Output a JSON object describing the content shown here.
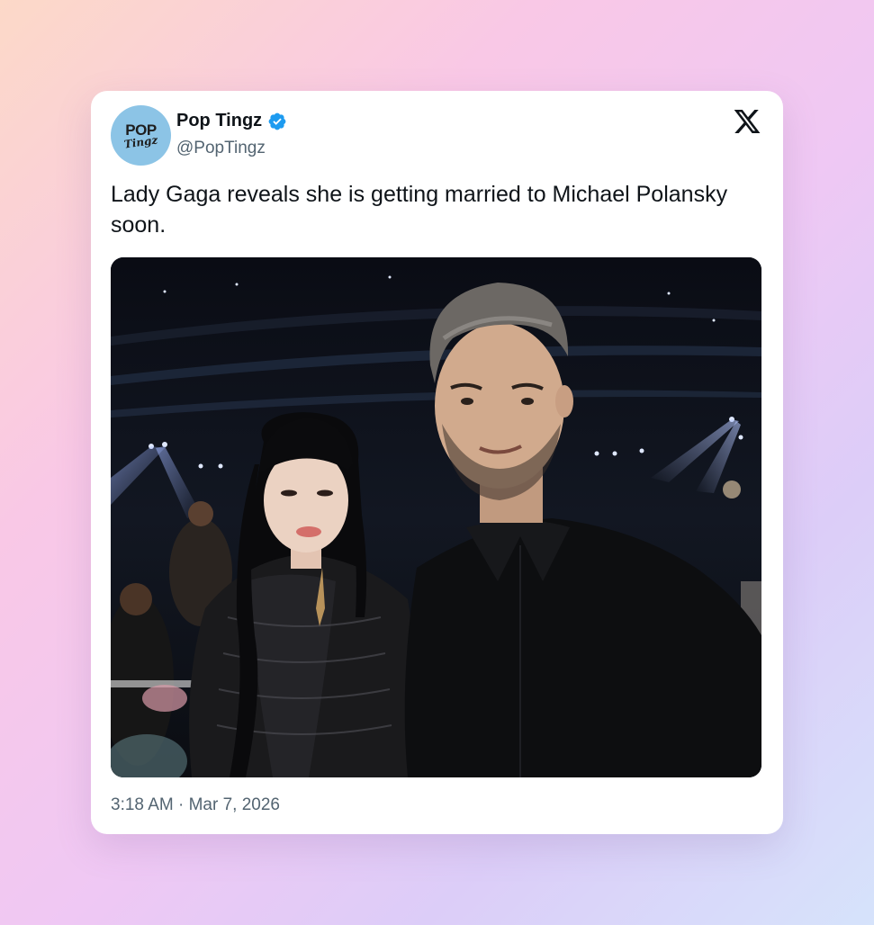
{
  "tweet": {
    "author": {
      "display_name": "Pop Tingz",
      "handle": "@PopTingz",
      "verified": true,
      "avatar_line1": "POP",
      "avatar_line2": "Tingz"
    },
    "text": "Lady Gaga reveals she is getting married to Michael Polansky soon.",
    "time": "3:18 AM",
    "date": "Mar 7, 2026",
    "platform_icon": "x-logo-icon",
    "media_icon": "photo-icon"
  },
  "colors": {
    "verified": "#1d9bf0",
    "avatar_bg": "#8cc4e6",
    "text_primary": "#0f1419",
    "text_secondary": "#536471"
  }
}
